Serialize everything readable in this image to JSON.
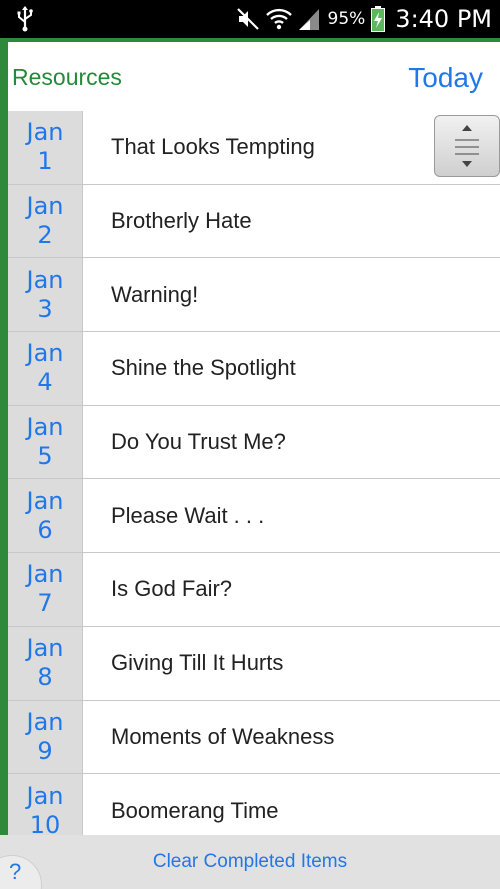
{
  "status_bar": {
    "battery_percent": "95%",
    "time": "3:40 PM",
    "icons": [
      "usb-icon",
      "mute-icon",
      "wifi-icon",
      "signal-icon",
      "battery-charging-icon"
    ]
  },
  "header": {
    "resources_label": "Resources",
    "today_label": "Today"
  },
  "colors": {
    "accent_green": "#2e8a3a",
    "link_blue": "#2277e8",
    "date_bg": "#dcdcdc"
  },
  "items": [
    {
      "month": "Jan",
      "day": "1",
      "title": "That Looks Tempting"
    },
    {
      "month": "Jan",
      "day": "2",
      "title": "Brotherly Hate"
    },
    {
      "month": "Jan",
      "day": "3",
      "title": "Warning!"
    },
    {
      "month": "Jan",
      "day": "4",
      "title": "Shine the Spotlight"
    },
    {
      "month": "Jan",
      "day": "5",
      "title": "Do You Trust Me?"
    },
    {
      "month": "Jan",
      "day": "6",
      "title": "Please Wait . . ."
    },
    {
      "month": "Jan",
      "day": "7",
      "title": "Is God Fair?"
    },
    {
      "month": "Jan",
      "day": "8",
      "title": "Giving Till It Hurts"
    },
    {
      "month": "Jan",
      "day": "9",
      "title": "Moments of Weakness"
    },
    {
      "month": "Jan",
      "day": "10",
      "title": "Boomerang Time"
    }
  ],
  "footer": {
    "clear_label": "Clear Completed Items",
    "help_label": "?"
  }
}
